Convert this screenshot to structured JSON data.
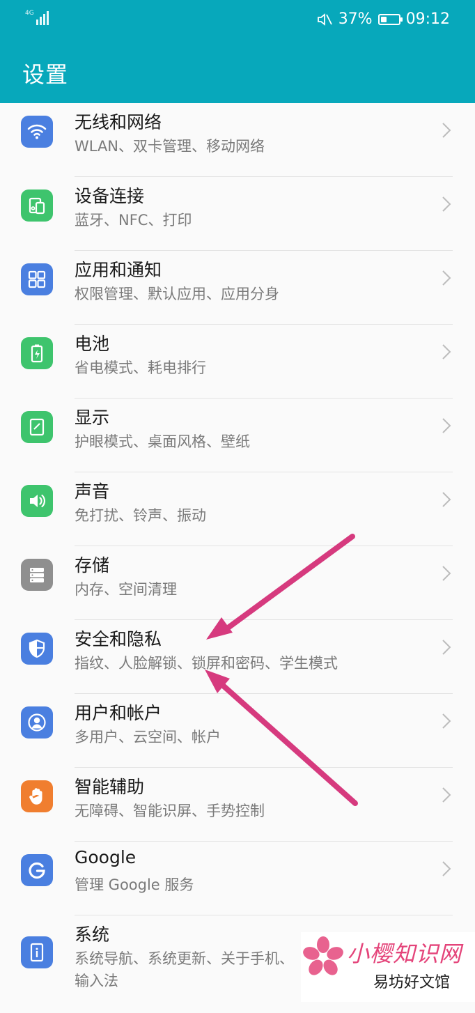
{
  "status_bar": {
    "network": "4G",
    "battery_text": "37%",
    "battery_level": 0.37,
    "time": "09:12",
    "icons": [
      "signal-icon",
      "mute-icon",
      "battery-icon"
    ]
  },
  "app_bar": {
    "title": "设置"
  },
  "items": [
    {
      "title": "无线和网络",
      "subtitle": "WLAN、双卡管理、移动网络",
      "icon": "wifi-icon",
      "color": "#4a7fe0"
    },
    {
      "title": "设备连接",
      "subtitle": "蓝牙、NFC、打印",
      "icon": "device-connect-icon",
      "color": "#3ec46d"
    },
    {
      "title": "应用和通知",
      "subtitle": "权限管理、默认应用、应用分身",
      "icon": "apps-icon",
      "color": "#4a7fe0"
    },
    {
      "title": "电池",
      "subtitle": "省电模式、耗电排行",
      "icon": "battery-icon",
      "color": "#3ec46d"
    },
    {
      "title": "显示",
      "subtitle": "护眼模式、桌面风格、壁纸",
      "icon": "display-icon",
      "color": "#3ec46d"
    },
    {
      "title": "声音",
      "subtitle": "免打扰、铃声、振动",
      "icon": "sound-icon",
      "color": "#3ec46d"
    },
    {
      "title": "存储",
      "subtitle": "内存、空间清理",
      "icon": "storage-icon",
      "color": "#8f8f8f"
    },
    {
      "title": "安全和隐私",
      "subtitle": "指纹、人脸解锁、锁屏和密码、学生模式",
      "icon": "shield-icon",
      "color": "#4a7fe0"
    },
    {
      "title": "用户和帐户",
      "subtitle": "多用户、云空间、帐户",
      "icon": "user-icon",
      "color": "#4a7fe0"
    },
    {
      "title": "智能辅助",
      "subtitle": "无障碍、智能识屏、手势控制",
      "icon": "hand-icon",
      "color": "#f07e2f"
    },
    {
      "title": "Google",
      "subtitle": "管理 Google 服务",
      "icon": "google-icon",
      "color": "#4a7fe0"
    },
    {
      "title": "系统",
      "subtitle": "系统导航、系统更新、关于手机、",
      "subtitle2": "输入法",
      "icon": "system-icon",
      "color": "#4a7fe0"
    }
  ],
  "annotation": {
    "arrow_color": "#d63a7e"
  },
  "watermark": {
    "main_text": "小樱知识网",
    "sub_text": "易坊好文馆"
  }
}
